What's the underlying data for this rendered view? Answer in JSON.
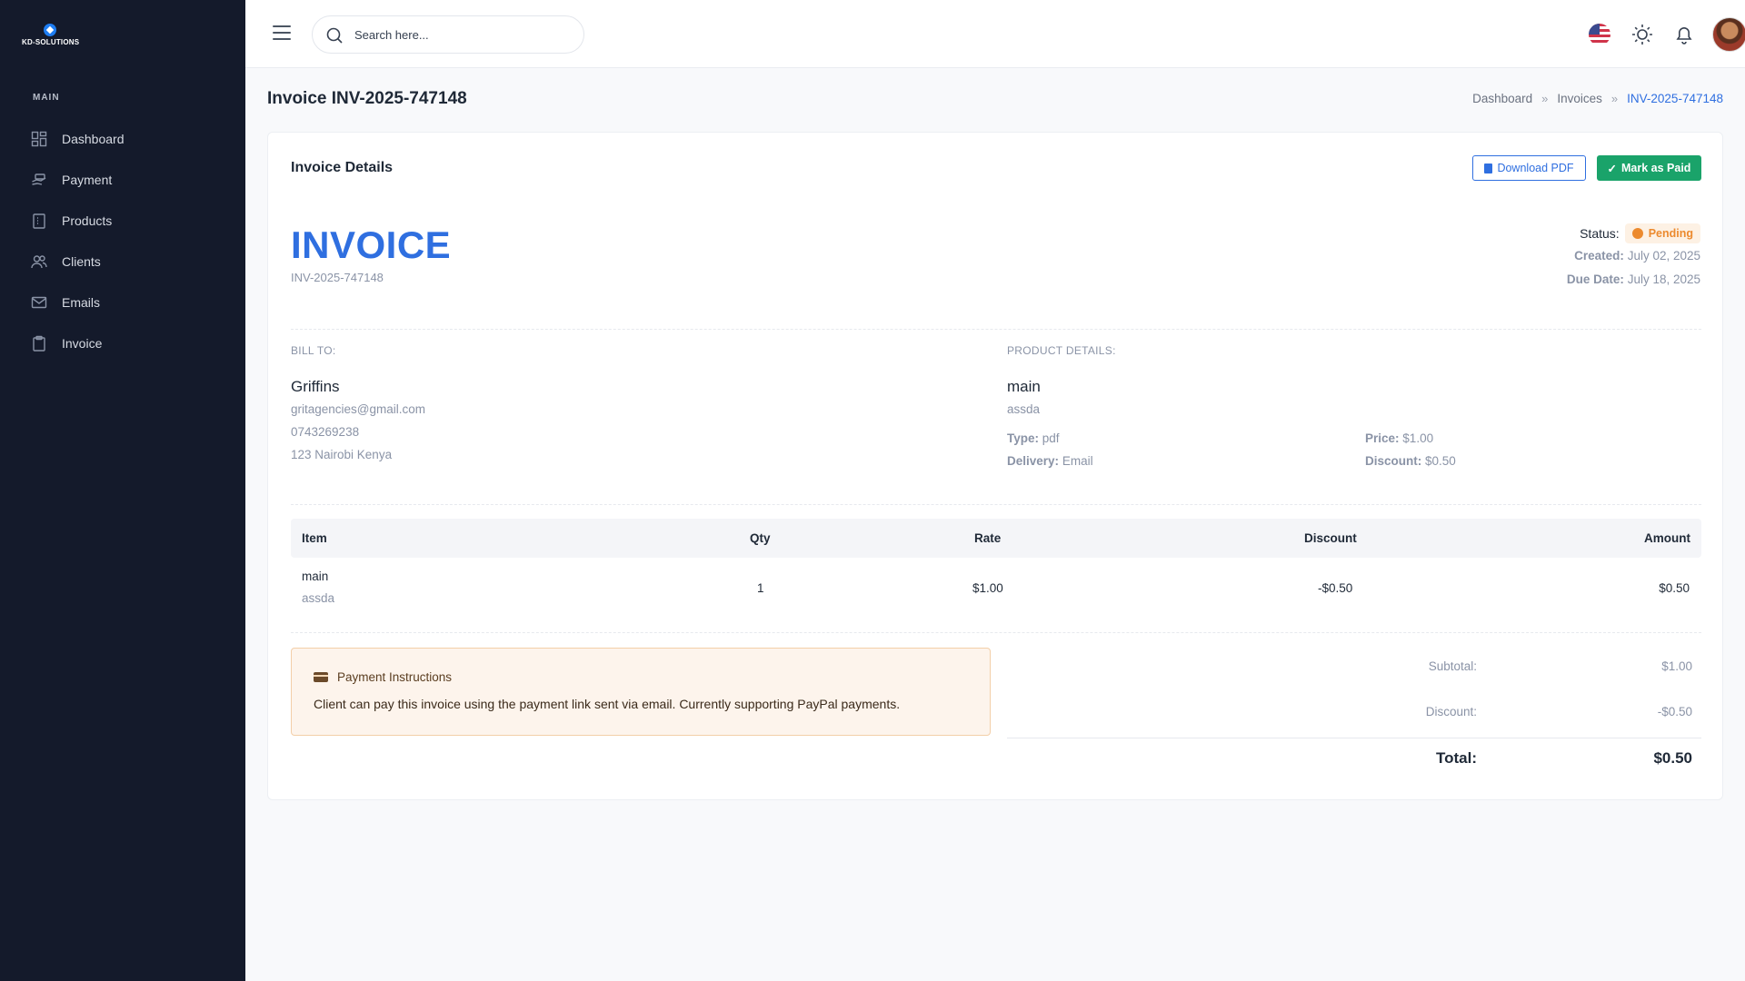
{
  "brand": {
    "name": "KD-SOLUTIONS"
  },
  "sidebar": {
    "section_title": "MAIN",
    "items": [
      {
        "label": "Dashboard",
        "icon": "grid-icon"
      },
      {
        "label": "Payment",
        "icon": "hand-cash-icon"
      },
      {
        "label": "Products",
        "icon": "clipboard-icon"
      },
      {
        "label": "Clients",
        "icon": "users-icon"
      },
      {
        "label": "Emails",
        "icon": "mail-icon"
      },
      {
        "label": "Invoice",
        "icon": "document-icon"
      }
    ]
  },
  "header": {
    "search_placeholder": "Search here...",
    "icons": [
      "menu-icon",
      "search-icon",
      "us-flag-icon",
      "sun-icon",
      "bell-icon",
      "avatar"
    ]
  },
  "page": {
    "title": "Invoice INV-2025-747148",
    "breadcrumb": [
      "Dashboard",
      "Invoices",
      "INV-2025-747148"
    ]
  },
  "card": {
    "title": "Invoice Details",
    "download_label": "Download PDF",
    "mark_paid_label": "Mark as Paid"
  },
  "invoice": {
    "heading": "INVOICE",
    "number": "INV-2025-747148",
    "status_label": "Status:",
    "status": "Pending",
    "created_label": "Created:",
    "created": "July 02, 2025",
    "due_label": "Due Date:",
    "due": "July 18, 2025"
  },
  "bill_to": {
    "label": "BILL TO:",
    "name": "Griffins",
    "email": "gritagencies@gmail.com",
    "phone": "0743269238",
    "address": "123 Nairobi Kenya"
  },
  "product": {
    "label": "PRODUCT DETAILS:",
    "name": "main",
    "desc": "assda",
    "type_label": "Type:",
    "type": "pdf",
    "delivery_label": "Delivery:",
    "delivery": "Email",
    "price_label": "Price:",
    "price": "$1.00",
    "discount_label": "Discount:",
    "discount": "$0.50"
  },
  "table": {
    "headers": [
      "Item",
      "Qty",
      "Rate",
      "Discount",
      "Amount"
    ],
    "rows": [
      {
        "item": "main",
        "desc": "assda",
        "qty": "1",
        "rate": "$1.00",
        "discount": "-$0.50",
        "amount": "$0.50"
      }
    ]
  },
  "payment": {
    "title": "Payment Instructions",
    "text": "Client can pay this invoice using the payment link sent via email. Currently supporting PayPal payments."
  },
  "totals": {
    "subtotal_label": "Subtotal:",
    "subtotal": "$1.00",
    "discount_label": "Discount:",
    "discount": "-$0.50",
    "total_label": "Total:",
    "total": "$0.50"
  },
  "colors": {
    "sidebar_bg": "#141a2b",
    "accent": "#2f6fe0",
    "success": "#1aa36a",
    "pending": "#ec8a2e"
  }
}
